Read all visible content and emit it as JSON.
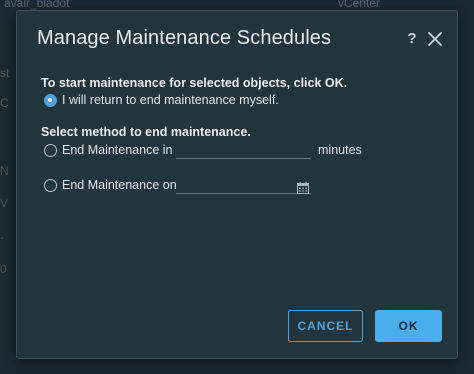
{
  "background": {
    "top_left_text": "avair_bladot",
    "top_right_text": "vCenter",
    "left_fragments": [
      "st",
      "C",
      "N",
      "V",
      "-",
      "0"
    ]
  },
  "dialog": {
    "title": "Manage Maintenance Schedules",
    "help_icon": "?",
    "close_icon": "close-icon"
  },
  "start_section": {
    "heading": "To start maintenance for selected objects, click OK.",
    "option_label": "I will return to end maintenance myself."
  },
  "end_section": {
    "heading": "Select method to end maintenance.",
    "option_in_label": "End Maintenance in",
    "minutes_value": "",
    "minutes_unit": "minutes",
    "option_on_label": "End Maintenance on",
    "date_value": ""
  },
  "buttons": {
    "cancel": "CANCEL",
    "ok": "OK"
  },
  "colors": {
    "accent": "#4aa3df",
    "ok_fill": "#49aeea",
    "dialog_bg": "#22343c"
  }
}
